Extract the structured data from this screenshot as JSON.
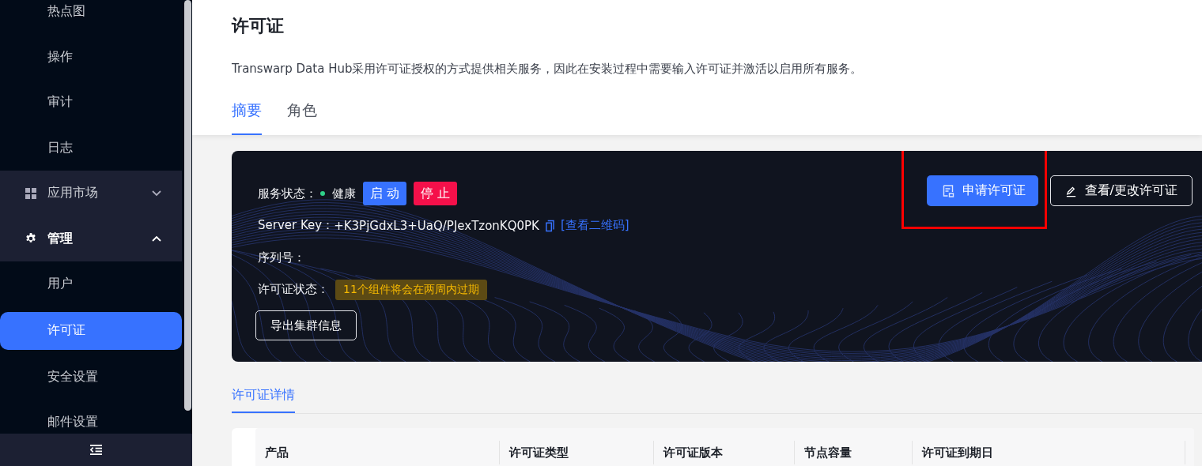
{
  "sidebar": {
    "items": [
      {
        "kind": "sub",
        "label": "热点图",
        "selected": false
      },
      {
        "kind": "sub",
        "label": "操作",
        "selected": false
      },
      {
        "kind": "sub",
        "label": "审计",
        "selected": false
      },
      {
        "kind": "sub",
        "label": "日志",
        "selected": false
      },
      {
        "kind": "group",
        "label": "应用市场",
        "expanded": false,
        "selected": false
      },
      {
        "kind": "group",
        "label": "管理",
        "expanded": true,
        "selected": false
      },
      {
        "kind": "sub",
        "label": "用户",
        "selected": false
      },
      {
        "kind": "sub",
        "label": "许可证",
        "selected": true
      },
      {
        "kind": "sub",
        "label": "安全设置",
        "selected": false
      },
      {
        "kind": "sub",
        "label": "邮件设置",
        "selected": false
      }
    ]
  },
  "page": {
    "title": "许可证",
    "description": "Transwarp Data Hub采用许可证授权的方式提供相关服务，因此在安装过程中需要输入许可证并激活以启用所有服务。"
  },
  "tabs": [
    {
      "label": "摘要",
      "selected": true
    },
    {
      "label": "角色",
      "selected": false
    }
  ],
  "summary": {
    "service_status_label": "服务状态：",
    "service_status": "健康",
    "start_button": "启 动",
    "stop_button": "停 止",
    "server_key_label": "Server Key：",
    "server_key": "+K3PjGdxL3+UaQ/PJexTzonKQ0PK",
    "qr_link": "[查看二维码]",
    "serial_label": "序列号：",
    "license_status_label": "许可证状态：",
    "license_status": "11个组件将会在两周内过期",
    "export_button": "导出集群信息",
    "apply_button": "申请许可证",
    "edit_button": "查看/更改许可证"
  },
  "details": {
    "tab": "许可证详情",
    "table": {
      "columns": [
        "产品",
        "许可证类型",
        "许可证版本",
        "节点容量",
        "许可证到期日"
      ]
    }
  }
}
